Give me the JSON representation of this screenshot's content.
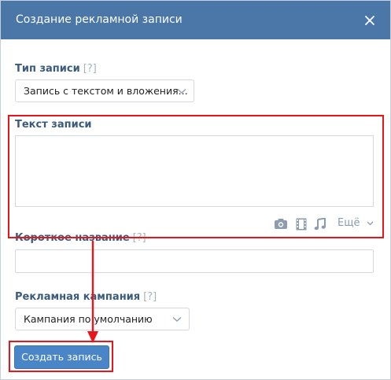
{
  "header": {
    "title": "Создание рекламной записи"
  },
  "record_type": {
    "label": "Тип записи",
    "help": "[?]",
    "selected": "Запись с текстом и вложения..."
  },
  "record_text": {
    "label": "Текст записи",
    "value": "",
    "toolbar": {
      "icons": [
        "camera-icon",
        "film-icon",
        "music-icon"
      ],
      "more_label": "Ещё"
    }
  },
  "short_name": {
    "label": "Короткое название",
    "help": "[?]",
    "value": ""
  },
  "campaign": {
    "label": "Рекламная кампания",
    "help": "[?]",
    "selected": "Кампания по умолчанию"
  },
  "actions": {
    "create_label": "Создать запись"
  },
  "colors": {
    "header_bg": "#4a76a8",
    "label": "#3b5b7d",
    "primary_button": "#4a86c7",
    "highlight": "#e8151b"
  }
}
